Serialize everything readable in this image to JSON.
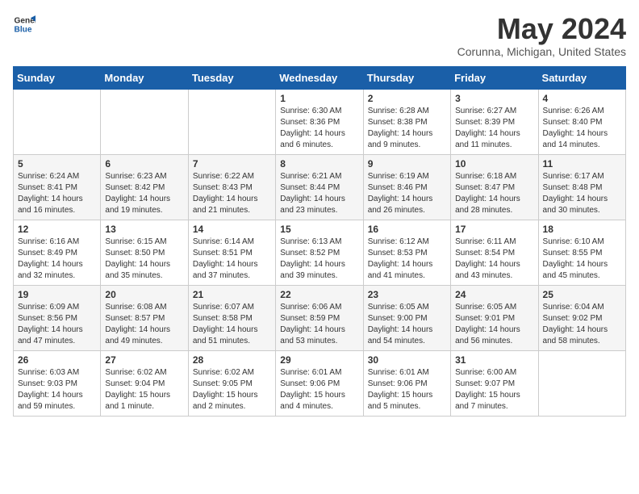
{
  "logo": {
    "line1": "General",
    "line2": "Blue"
  },
  "title": "May 2024",
  "location": "Corunna, Michigan, United States",
  "weekdays": [
    "Sunday",
    "Monday",
    "Tuesday",
    "Wednesday",
    "Thursday",
    "Friday",
    "Saturday"
  ],
  "weeks": [
    [
      {
        "day": "",
        "info": ""
      },
      {
        "day": "",
        "info": ""
      },
      {
        "day": "",
        "info": ""
      },
      {
        "day": "1",
        "info": "Sunrise: 6:30 AM\nSunset: 8:36 PM\nDaylight: 14 hours\nand 6 minutes."
      },
      {
        "day": "2",
        "info": "Sunrise: 6:28 AM\nSunset: 8:38 PM\nDaylight: 14 hours\nand 9 minutes."
      },
      {
        "day": "3",
        "info": "Sunrise: 6:27 AM\nSunset: 8:39 PM\nDaylight: 14 hours\nand 11 minutes."
      },
      {
        "day": "4",
        "info": "Sunrise: 6:26 AM\nSunset: 8:40 PM\nDaylight: 14 hours\nand 14 minutes."
      }
    ],
    [
      {
        "day": "5",
        "info": "Sunrise: 6:24 AM\nSunset: 8:41 PM\nDaylight: 14 hours\nand 16 minutes."
      },
      {
        "day": "6",
        "info": "Sunrise: 6:23 AM\nSunset: 8:42 PM\nDaylight: 14 hours\nand 19 minutes."
      },
      {
        "day": "7",
        "info": "Sunrise: 6:22 AM\nSunset: 8:43 PM\nDaylight: 14 hours\nand 21 minutes."
      },
      {
        "day": "8",
        "info": "Sunrise: 6:21 AM\nSunset: 8:44 PM\nDaylight: 14 hours\nand 23 minutes."
      },
      {
        "day": "9",
        "info": "Sunrise: 6:19 AM\nSunset: 8:46 PM\nDaylight: 14 hours\nand 26 minutes."
      },
      {
        "day": "10",
        "info": "Sunrise: 6:18 AM\nSunset: 8:47 PM\nDaylight: 14 hours\nand 28 minutes."
      },
      {
        "day": "11",
        "info": "Sunrise: 6:17 AM\nSunset: 8:48 PM\nDaylight: 14 hours\nand 30 minutes."
      }
    ],
    [
      {
        "day": "12",
        "info": "Sunrise: 6:16 AM\nSunset: 8:49 PM\nDaylight: 14 hours\nand 32 minutes."
      },
      {
        "day": "13",
        "info": "Sunrise: 6:15 AM\nSunset: 8:50 PM\nDaylight: 14 hours\nand 35 minutes."
      },
      {
        "day": "14",
        "info": "Sunrise: 6:14 AM\nSunset: 8:51 PM\nDaylight: 14 hours\nand 37 minutes."
      },
      {
        "day": "15",
        "info": "Sunrise: 6:13 AM\nSunset: 8:52 PM\nDaylight: 14 hours\nand 39 minutes."
      },
      {
        "day": "16",
        "info": "Sunrise: 6:12 AM\nSunset: 8:53 PM\nDaylight: 14 hours\nand 41 minutes."
      },
      {
        "day": "17",
        "info": "Sunrise: 6:11 AM\nSunset: 8:54 PM\nDaylight: 14 hours\nand 43 minutes."
      },
      {
        "day": "18",
        "info": "Sunrise: 6:10 AM\nSunset: 8:55 PM\nDaylight: 14 hours\nand 45 minutes."
      }
    ],
    [
      {
        "day": "19",
        "info": "Sunrise: 6:09 AM\nSunset: 8:56 PM\nDaylight: 14 hours\nand 47 minutes."
      },
      {
        "day": "20",
        "info": "Sunrise: 6:08 AM\nSunset: 8:57 PM\nDaylight: 14 hours\nand 49 minutes."
      },
      {
        "day": "21",
        "info": "Sunrise: 6:07 AM\nSunset: 8:58 PM\nDaylight: 14 hours\nand 51 minutes."
      },
      {
        "day": "22",
        "info": "Sunrise: 6:06 AM\nSunset: 8:59 PM\nDaylight: 14 hours\nand 53 minutes."
      },
      {
        "day": "23",
        "info": "Sunrise: 6:05 AM\nSunset: 9:00 PM\nDaylight: 14 hours\nand 54 minutes."
      },
      {
        "day": "24",
        "info": "Sunrise: 6:05 AM\nSunset: 9:01 PM\nDaylight: 14 hours\nand 56 minutes."
      },
      {
        "day": "25",
        "info": "Sunrise: 6:04 AM\nSunset: 9:02 PM\nDaylight: 14 hours\nand 58 minutes."
      }
    ],
    [
      {
        "day": "26",
        "info": "Sunrise: 6:03 AM\nSunset: 9:03 PM\nDaylight: 14 hours\nand 59 minutes."
      },
      {
        "day": "27",
        "info": "Sunrise: 6:02 AM\nSunset: 9:04 PM\nDaylight: 15 hours\nand 1 minute."
      },
      {
        "day": "28",
        "info": "Sunrise: 6:02 AM\nSunset: 9:05 PM\nDaylight: 15 hours\nand 2 minutes."
      },
      {
        "day": "29",
        "info": "Sunrise: 6:01 AM\nSunset: 9:06 PM\nDaylight: 15 hours\nand 4 minutes."
      },
      {
        "day": "30",
        "info": "Sunrise: 6:01 AM\nSunset: 9:06 PM\nDaylight: 15 hours\nand 5 minutes."
      },
      {
        "day": "31",
        "info": "Sunrise: 6:00 AM\nSunset: 9:07 PM\nDaylight: 15 hours\nand 7 minutes."
      },
      {
        "day": "",
        "info": ""
      }
    ]
  ]
}
